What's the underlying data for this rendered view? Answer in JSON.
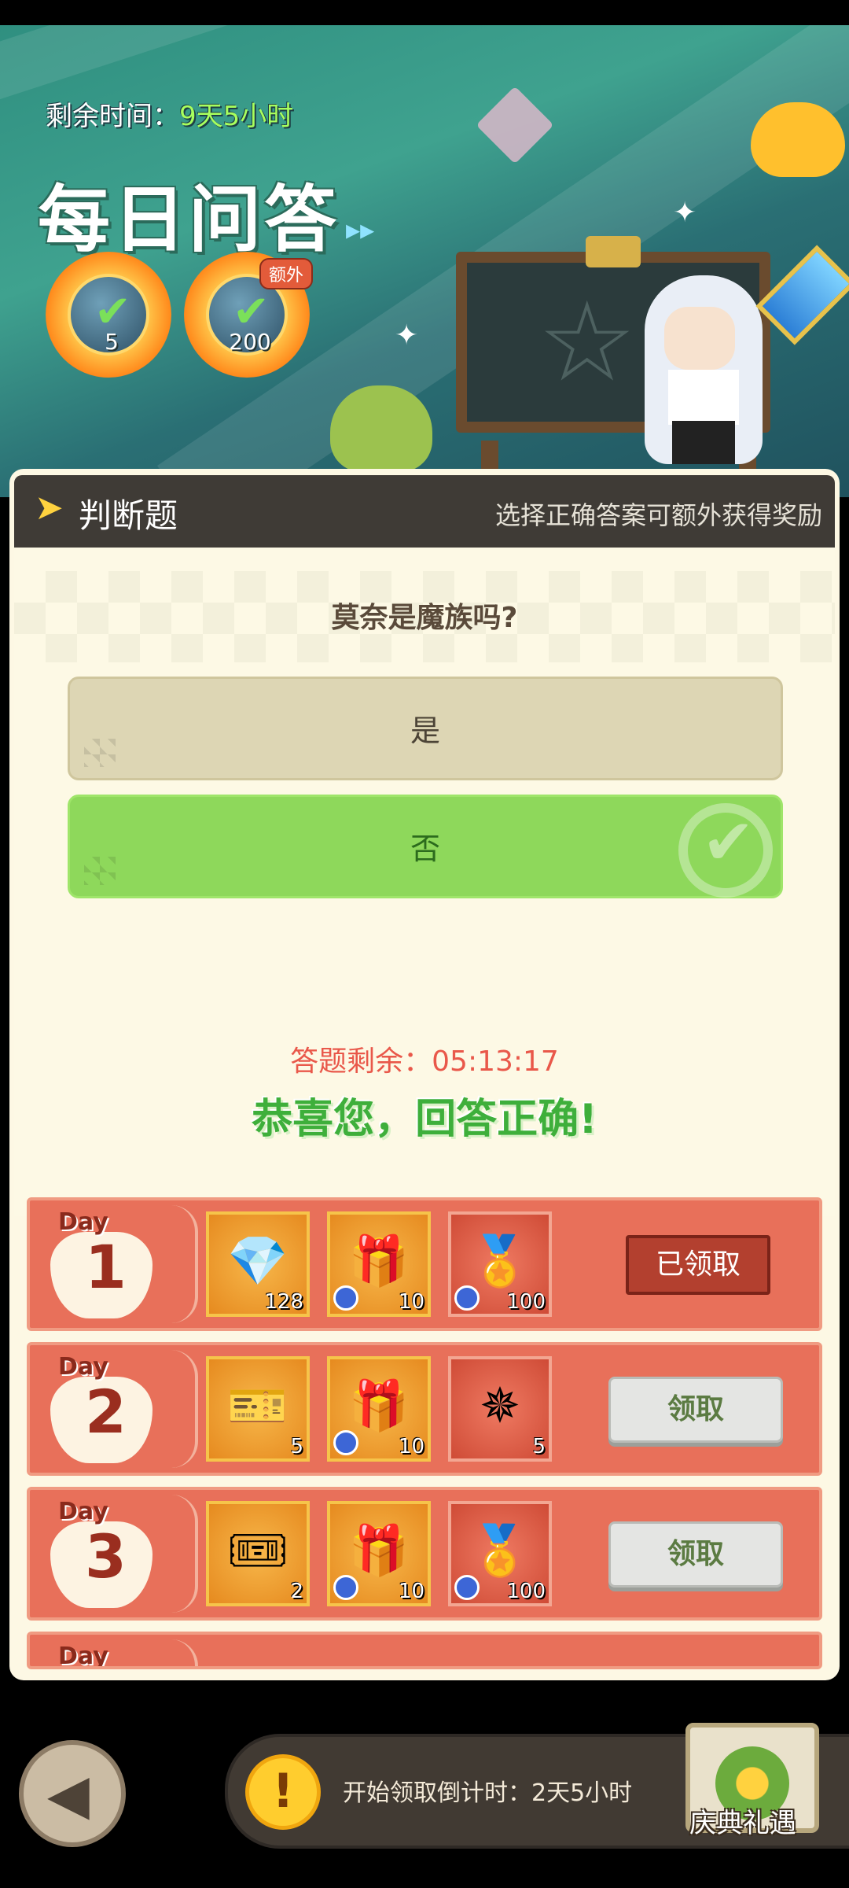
{
  "banner": {
    "remaining_label": "剩余时间：",
    "remaining_value": "9天5小时",
    "title": "每日问答",
    "medals": [
      {
        "icon": "puzzle-check-icon",
        "count": "5"
      },
      {
        "icon": "crystal-check-icon",
        "count": "200",
        "badge": "额外"
      }
    ]
  },
  "panel": {
    "type_label": "判断题",
    "hint": "选择正确答案可额外获得奖励",
    "question": "莫奈是魔族吗?",
    "options": [
      {
        "label": "是",
        "state": "default"
      },
      {
        "label": "否",
        "state": "correct"
      }
    ],
    "countdown": "答题剩余：05:13:17",
    "result": "恭喜您，回答正确!"
  },
  "rewards": [
    {
      "day_label": "Day",
      "day": "1",
      "items": [
        {
          "icon": "diamond-icon",
          "qty": "128",
          "timed": false,
          "style": "gold"
        },
        {
          "icon": "gift-box-icon",
          "qty": "10",
          "timed": true,
          "style": "gold"
        },
        {
          "icon": "gem-medal-icon",
          "qty": "100",
          "timed": true,
          "style": "red"
        }
      ],
      "button": "已领取",
      "claimed": true
    },
    {
      "day_label": "Day",
      "day": "2",
      "items": [
        {
          "icon": "fish-ticket-icon",
          "qty": "5",
          "timed": false,
          "style": "gold"
        },
        {
          "icon": "gift-box-icon",
          "qty": "10",
          "timed": true,
          "style": "gold"
        },
        {
          "icon": "leaf-emblem-icon",
          "qty": "5",
          "timed": false,
          "style": "red"
        }
      ],
      "button": "领取",
      "claimed": false
    },
    {
      "day_label": "Day",
      "day": "3",
      "items": [
        {
          "icon": "gold-ticket-icon",
          "qty": "2",
          "timed": false,
          "style": "gold"
        },
        {
          "icon": "gift-box-icon",
          "qty": "10",
          "timed": true,
          "style": "gold"
        },
        {
          "icon": "gem-medal-icon",
          "qty": "100",
          "timed": true,
          "style": "red"
        }
      ],
      "button": "领取",
      "claimed": false
    },
    {
      "day_label": "Day",
      "day": "",
      "items": [],
      "button": "",
      "claimed": false
    }
  ],
  "footer": {
    "notice": "开始领取倒计时：2天5小时",
    "gift_label": "庆典礼遇"
  },
  "colors": {
    "accent_green": "#8ed85b",
    "row_red": "#e8705a",
    "countdown_red": "#e9584a",
    "correct_green": "#3eaf3b"
  }
}
